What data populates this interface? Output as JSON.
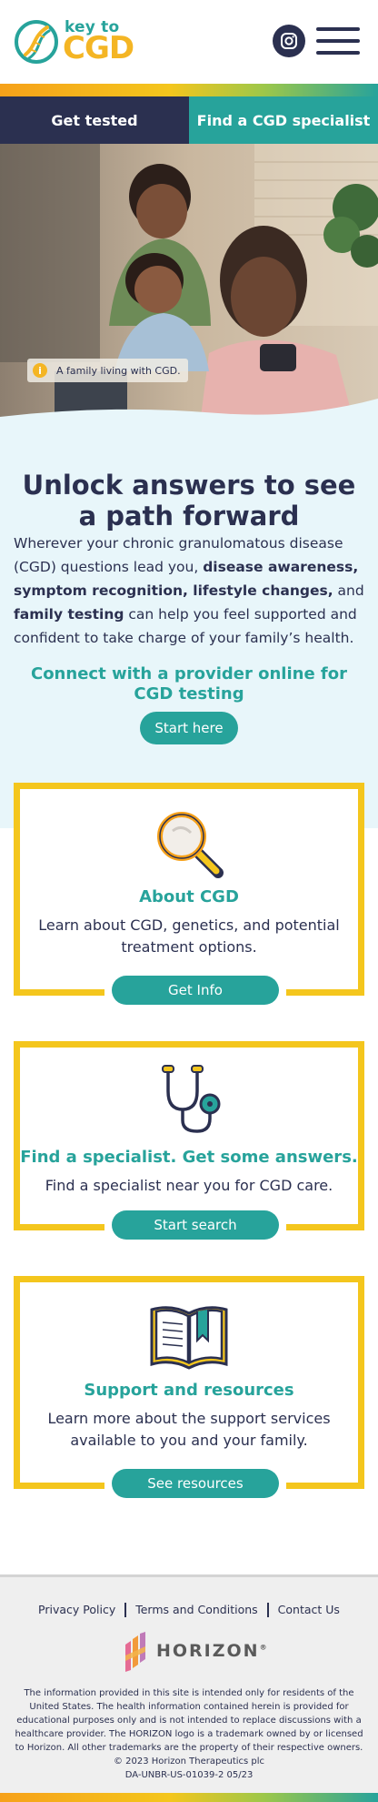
{
  "header": {
    "logo_small": "key to",
    "logo_big": "CGD",
    "instagram_icon": "instagram-icon",
    "menu_icon": "hamburger-menu-icon"
  },
  "cta": {
    "left_label": "Get tested",
    "right_label": "Find a CGD specialist"
  },
  "hero": {
    "caption": "A family living with CGD.",
    "caption_icon": "info-icon",
    "info_glyph": "i"
  },
  "intro": {
    "title": "Unlock answers to see a path forward",
    "body_parts": [
      "Wherever your chronic granulomatous disease (CGD) questions lead you, ",
      "disease awareness, symptom recognition, lifestyle changes,",
      " and ",
      "family testing",
      " can help you feel supported and confident to take charge of your family’s health."
    ],
    "subheading": "Connect with a provider online for CGD testing",
    "button_label": "Start here"
  },
  "cards": [
    {
      "icon": "magnifying-glass-icon",
      "title": "About CGD",
      "text": "Learn about CGD, genetics, and potential treatment options.",
      "button_label": "Get Info"
    },
    {
      "icon": "stethoscope-icon",
      "title": "Find a specialist. Get some answers.",
      "text": "Find a specialist near you for CGD care.",
      "button_label": "Start search"
    },
    {
      "icon": "open-book-icon",
      "title": "Support and resources",
      "text": "Learn more about the support services available to you and your family.",
      "button_label": "See resources"
    }
  ],
  "footer": {
    "links": [
      "Privacy Policy",
      "Terms and Conditions",
      "Contact Us"
    ],
    "brand": "HORIZON",
    "brand_mark": "®",
    "disclaimer_lines": [
      "The information provided in this site is intended only for residents of the United States. The health information contained herein is provided for educational purposes only and is not intended to replace discussions with a healthcare provider. The HORIZON logo is a trademark owned by or licensed to Horizon. All other trademarks are the property of their respective owners.",
      "© 2023 Horizon Therapeutics plc",
      "DA-UNBR-US-01039-2 05/23"
    ]
  },
  "colors": {
    "navy": "#2b3050",
    "teal": "#27a39b",
    "yellow": "#f4c61d",
    "orange": "#f4b524",
    "light_blue": "#e8f6fa"
  }
}
